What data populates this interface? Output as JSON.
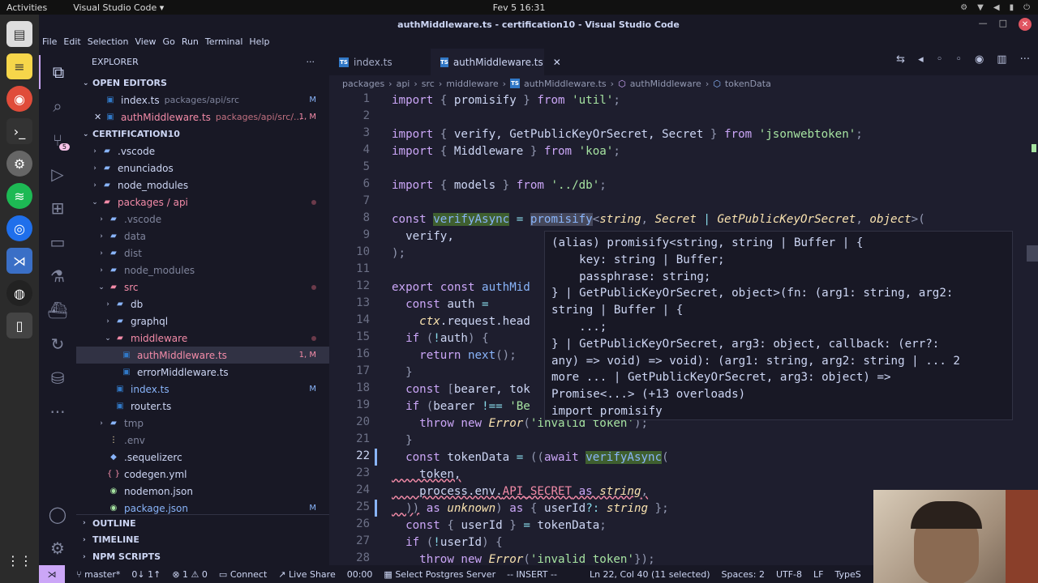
{
  "os": {
    "activities": "Activities",
    "app": "Visual Studio Code ▾",
    "clock": "Fev 5  16:31"
  },
  "window": {
    "title": "authMiddleware.ts - certification10 - Visual Studio Code"
  },
  "menu": [
    "File",
    "Edit",
    "Selection",
    "View",
    "Go",
    "Run",
    "Terminal",
    "Help"
  ],
  "explorer": {
    "title": "EXPLORER",
    "more": "···",
    "open_editors": "OPEN EDITORS",
    "oe1": {
      "name": "index.ts",
      "path": "packages/api/src",
      "status": "M"
    },
    "oe2": {
      "name": "authMiddleware.ts",
      "path": "packages/api/src/...",
      "status": "1, M"
    },
    "project": "CERTIFICATION10",
    "tree": [
      {
        "name": ".vscode",
        "indent": 1,
        "type": "folder",
        "chev": "›"
      },
      {
        "name": "enunciados",
        "indent": 1,
        "type": "folder",
        "chev": "›"
      },
      {
        "name": "node_modules",
        "indent": 1,
        "type": "folder",
        "chev": "›"
      },
      {
        "name": "packages / api",
        "indent": 1,
        "type": "folder-open",
        "chev": "⌄",
        "err": true
      },
      {
        "name": ".vscode",
        "indent": 2,
        "type": "folder",
        "chev": "›"
      },
      {
        "name": "data",
        "indent": 2,
        "type": "folder",
        "chev": "›"
      },
      {
        "name": "dist",
        "indent": 2,
        "type": "folder",
        "chev": "›"
      },
      {
        "name": "node_modules",
        "indent": 2,
        "type": "folder",
        "chev": "›"
      },
      {
        "name": "src",
        "indent": 2,
        "type": "folder-open",
        "chev": "⌄",
        "err": true
      },
      {
        "name": "db",
        "indent": 3,
        "type": "folder",
        "chev": "›"
      },
      {
        "name": "graphql",
        "indent": 3,
        "type": "folder",
        "chev": "›"
      },
      {
        "name": "middleware",
        "indent": 3,
        "type": "folder-open",
        "chev": "⌄",
        "err": true
      },
      {
        "name": "authMiddleware.ts",
        "indent": 4,
        "type": "ts",
        "status": "1, M",
        "selected": true,
        "err": true
      },
      {
        "name": "errorMiddleware.ts",
        "indent": 4,
        "type": "ts"
      },
      {
        "name": "index.ts",
        "indent": 3,
        "type": "ts",
        "status": "M"
      },
      {
        "name": "router.ts",
        "indent": 3,
        "type": "ts"
      },
      {
        "name": "tmp",
        "indent": 2,
        "type": "folder",
        "chev": "›"
      },
      {
        "name": ".env",
        "indent": 2,
        "type": "env"
      },
      {
        "name": ".sequelizerc",
        "indent": 2,
        "type": "seq"
      },
      {
        "name": "codegen.yml",
        "indent": 2,
        "type": "yml"
      },
      {
        "name": "nodemon.json",
        "indent": 2,
        "type": "json"
      },
      {
        "name": "package.json",
        "indent": 2,
        "type": "json",
        "status": "M"
      }
    ],
    "outline": "OUTLINE",
    "timeline": "TIMELINE",
    "npm": "NPM SCRIPTS"
  },
  "tabs": [
    {
      "label": "index.ts"
    },
    {
      "label": "authMiddleware.ts"
    }
  ],
  "breadcrumb": [
    "packages",
    "api",
    "src",
    "middleware",
    "authMiddleware.ts",
    "authMiddleware",
    "tokenData"
  ],
  "hover": {
    "text": "(alias) promisify<string, string | Buffer | {\n    key: string | Buffer;\n    passphrase: string;\n} | GetPublicKeyOrSecret, object>(fn: (arg1: string, arg2:\nstring | Buffer | {\n    ...;\n} | GetPublicKeyOrSecret, arg3: object, callback: (err?:\nany) => void) => void): (arg1: string, arg2: string | ... 2\nmore ... | GetPublicKeyOrSecret, arg3: object) =>\nPromise<...> (+13 overloads)\nimport promisify"
  },
  "status": {
    "branch": "master*",
    "sync": "0↓ 1↑",
    "problems": "⊗ 1  ⚠ 0",
    "connect": "Connect",
    "liveshare": "Live Share",
    "time": "00:00",
    "pg": "Select Postgres Server",
    "mode": "-- INSERT --",
    "cursor": "Ln 22, Col 40 (11 selected)",
    "spaces": "Spaces: 2",
    "enc": "UTF-8",
    "eol": "LF",
    "lang": "TypeS"
  },
  "colors": {
    "accent": "#cba6f7",
    "bg": "#1e1e2e",
    "sidebar": "#181825",
    "error": "#f38ba8"
  }
}
